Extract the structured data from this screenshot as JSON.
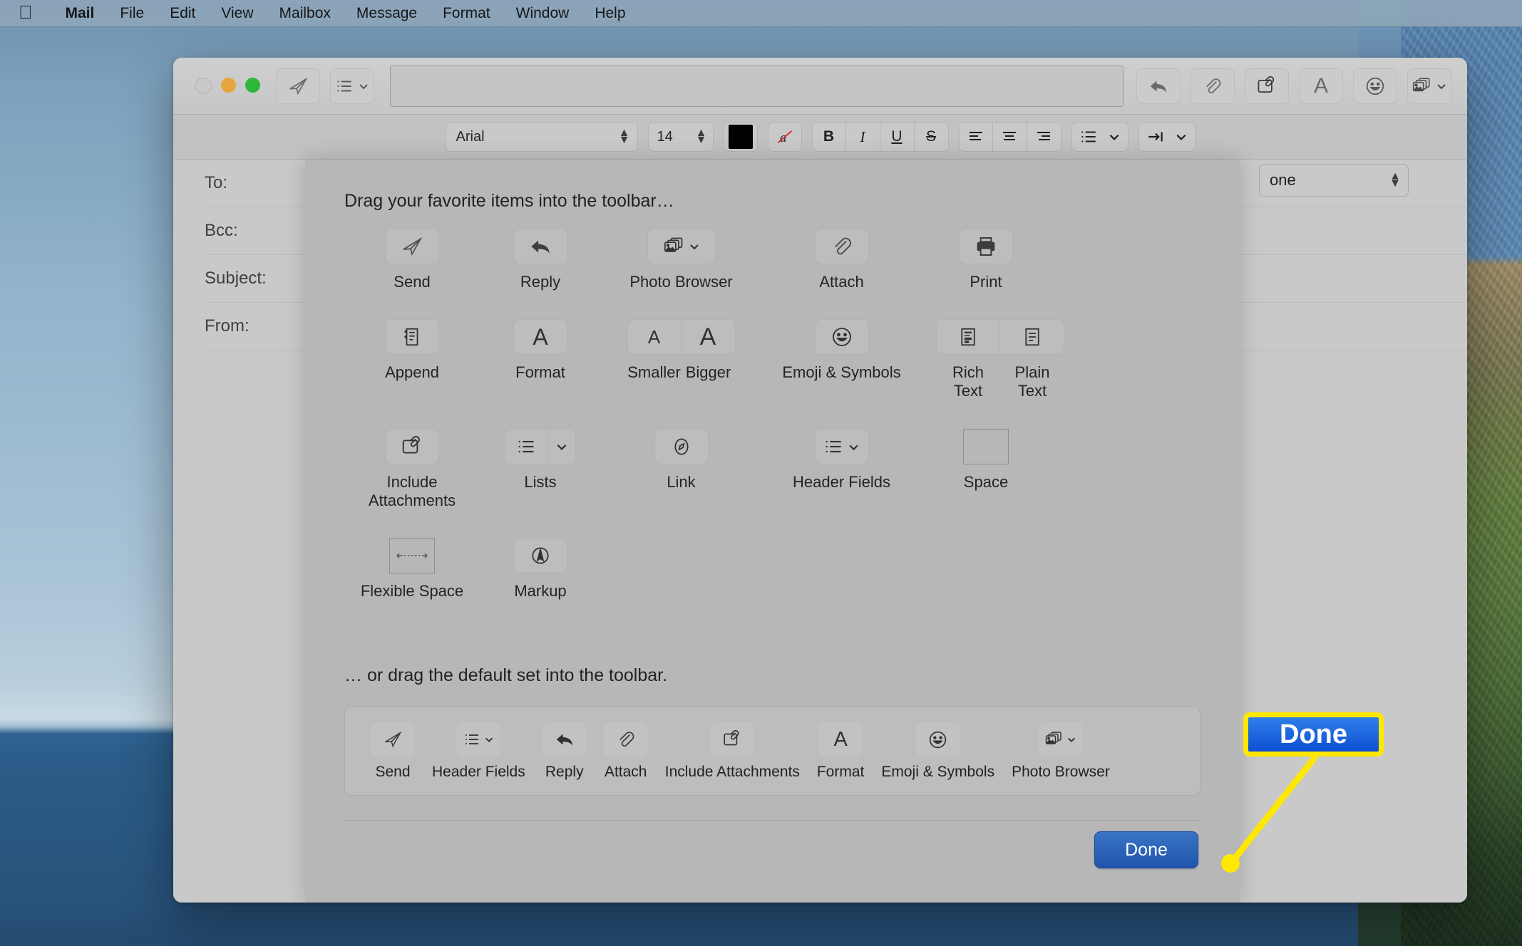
{
  "menubar": {
    "apple_icon": "apple-logo-icon",
    "items": [
      {
        "label": "Mail",
        "bold": true
      },
      {
        "label": "File",
        "bold": false
      },
      {
        "label": "Edit",
        "bold": false
      },
      {
        "label": "View",
        "bold": false
      },
      {
        "label": "Mailbox",
        "bold": false
      },
      {
        "label": "Message",
        "bold": false
      },
      {
        "label": "Format",
        "bold": false
      },
      {
        "label": "Window",
        "bold": false
      },
      {
        "label": "Help",
        "bold": false
      }
    ]
  },
  "window": {
    "title": "",
    "toolbar_left": [
      {
        "name": "send-toolbar-button",
        "icon": "paper-plane-icon"
      },
      {
        "name": "header-fields-toolbar-button",
        "icon": "list-icon",
        "has_chevron": true
      }
    ],
    "address_field_value": "",
    "toolbar_right": [
      {
        "name": "reply-toolbar-button",
        "icon": "reply-arrow-icon"
      },
      {
        "name": "attach-toolbar-button",
        "icon": "paperclip-icon"
      },
      {
        "name": "include-attachments-toolbar-button",
        "icon": "document-paperclip-icon"
      },
      {
        "name": "format-toolbar-button",
        "icon": "letter-a-icon"
      },
      {
        "name": "emoji-toolbar-button",
        "icon": "smiley-face-icon"
      },
      {
        "name": "photo-browser-toolbar-button",
        "icon": "photos-stack-icon",
        "has_chevron": true
      }
    ]
  },
  "format_bar": {
    "font_family": "Arial",
    "font_size": "14",
    "color_swatch": "#000000",
    "highlight_icon": "strikethrough-a-icon",
    "style_buttons": [
      {
        "label": "B",
        "name": "bold-button"
      },
      {
        "label": "I",
        "name": "italic-button"
      },
      {
        "label": "U",
        "name": "underline-button"
      },
      {
        "label": "S",
        "name": "strikethrough-button"
      }
    ],
    "align_buttons": [
      {
        "name": "align-left-button"
      },
      {
        "name": "align-center-button"
      },
      {
        "name": "align-right-button"
      }
    ],
    "list_button": "lists-button",
    "indent_button": "indent-button"
  },
  "compose": {
    "fields": [
      {
        "label": "To:",
        "value": "",
        "name": "to-field"
      },
      {
        "label": "Bcc:",
        "value": "",
        "name": "bcc-field"
      },
      {
        "label": "Subject:",
        "value": "",
        "name": "subject-field"
      },
      {
        "label": "From:",
        "value": "",
        "redacted": true,
        "name": "from-field"
      }
    ],
    "signature_select_value": "one"
  },
  "sheet": {
    "heading_top": "Drag your favorite items into the toolbar…",
    "heading_bottom": "… or drag the default set into the toolbar.",
    "rows": [
      [
        {
          "label": "Send",
          "icon": "paper-plane-icon",
          "type": "button"
        },
        {
          "label": "Reply",
          "icon": "reply-arrow-icon",
          "type": "button"
        },
        {
          "label": "Photo Browser",
          "icon": "photos-stack-icon",
          "type": "button",
          "chevron": true
        },
        {
          "label": "Attach",
          "icon": "paperclip-icon",
          "type": "button"
        },
        {
          "label": "Print",
          "icon": "printer-icon",
          "type": "button"
        }
      ],
      [
        {
          "label": "Append",
          "icon": "append-document-icon",
          "type": "button"
        },
        {
          "label": "Format",
          "icon": "letter-a-icon",
          "type": "button"
        },
        {
          "labels": [
            "Smaller",
            "Bigger"
          ],
          "icons": [
            "small-a-icon",
            "big-a-icon"
          ],
          "type": "pair"
        },
        {
          "label": "Emoji & Symbols",
          "icon": "smiley-face-icon",
          "type": "button"
        },
        {
          "labels": [
            "Rich Text",
            "Plain Text"
          ],
          "icons": [
            "rich-text-doc-icon",
            "plain-text-doc-icon"
          ],
          "type": "pair"
        }
      ],
      [
        {
          "label": "Include Attachments",
          "icon": "document-paperclip-icon",
          "type": "button"
        },
        {
          "label": "Lists",
          "icon": "list-icon",
          "type": "button",
          "chevron_split": true
        },
        {
          "label": "Link",
          "icon": "compass-link-icon",
          "type": "button"
        },
        {
          "label": "Header Fields",
          "icon": "list-icon",
          "type": "button",
          "chevron": true
        },
        {
          "label": "Space",
          "icon": "empty-box-icon",
          "type": "box"
        }
      ],
      [
        {
          "label": "Flexible Space",
          "icon": "flexible-space-arrow-icon",
          "type": "box"
        },
        {
          "label": "Markup",
          "icon": "markup-pen-circle-icon",
          "type": "button"
        }
      ]
    ],
    "default_set": [
      {
        "label": "Send",
        "icon": "paper-plane-icon"
      },
      {
        "label": "Header Fields",
        "icon": "list-icon",
        "chevron": true
      },
      {
        "label": "Reply",
        "icon": "reply-arrow-icon"
      },
      {
        "label": "Attach",
        "icon": "paperclip-icon"
      },
      {
        "label": "Include Attachments",
        "icon": "document-paperclip-icon"
      },
      {
        "label": "Format",
        "icon": "letter-a-icon"
      },
      {
        "label": "Emoji & Symbols",
        "icon": "smiley-face-icon"
      },
      {
        "label": "Photo Browser",
        "icon": "photos-stack-icon",
        "chevron": true
      }
    ],
    "done_label": "Done"
  },
  "annotation": {
    "callout_label": "Done",
    "border_color": "#ffe800",
    "fill_color": "#1f5fd8",
    "leader_color": "#ffe800"
  }
}
